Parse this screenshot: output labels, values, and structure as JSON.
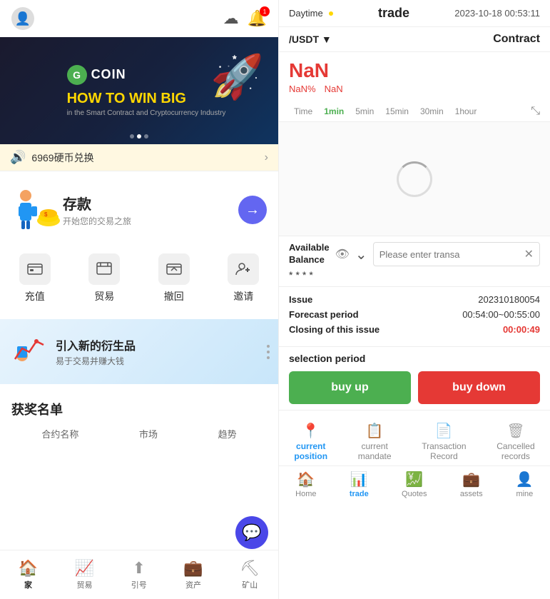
{
  "left": {
    "promo": {
      "icon": "🔊",
      "text": "6969硬币兑换",
      "arrow": "›"
    },
    "banner": {
      "logo": "G",
      "logo_text": "COIN",
      "line1": "HOW TO WIN BIG",
      "line2": "in the Smart Contract and Cryptocurrency Industry"
    },
    "deposit": {
      "title": "存款",
      "subtitle": "开始您的交易之旅"
    },
    "actions": [
      {
        "icon": "💳",
        "label": "充值"
      },
      {
        "icon": "📊",
        "label": "贸易"
      },
      {
        "icon": "↩",
        "label": "撤回"
      },
      {
        "icon": "👤",
        "label": "邀请"
      }
    ],
    "derivatives": {
      "title": "引入新的衍生品",
      "subtitle": "易于交易并赚大钱"
    },
    "winners": {
      "title": "获奖名单",
      "cols": [
        "合约名称",
        "市场",
        "趋势"
      ]
    },
    "nav": [
      {
        "icon": "🏠",
        "label": "家",
        "active": true
      },
      {
        "icon": "📈",
        "label": "贸易",
        "active": false
      },
      {
        "icon": "⬆",
        "label": "引号",
        "active": false
      },
      {
        "icon": "💼",
        "label": "资产",
        "active": false
      },
      {
        "icon": "⛏",
        "label": "矿山",
        "active": false
      }
    ]
  },
  "right": {
    "header": {
      "day": "Daytime",
      "day_dot_color": "#FFD700",
      "title": "trade",
      "time": "2023-10-18 00:53:11"
    },
    "pair": "/USDT ▼",
    "contract": "Contract",
    "price": {
      "main": "NaN",
      "pct": "NaN%",
      "val": "NaN"
    },
    "time_tabs": [
      "Time",
      "1min",
      "5min",
      "15min",
      "30min",
      "1hour"
    ],
    "active_tab": "1min",
    "balance": {
      "label": "Available\nBalance",
      "stars": "****",
      "placeholder": "Please enter transa"
    },
    "trade_info": {
      "issue_key": "Issue",
      "issue_val": "202310180054",
      "forecast_key": "Forecast period",
      "forecast_val": "00:54:00~00:55:00",
      "closing_key": "Closing of this issue",
      "closing_val": "00:00:49"
    },
    "selection": {
      "label": "selection period",
      "buy_up": "buy up",
      "buy_down": "buy down"
    },
    "tabs": [
      {
        "icon": "📍",
        "label": "current\nposition",
        "active": true
      },
      {
        "icon": "📋",
        "label": "current\nmandate",
        "active": false
      },
      {
        "icon": "📄",
        "label": "Transaction\nRecord",
        "active": false
      },
      {
        "icon": "🗑",
        "label": "Cancelled\nrecords",
        "active": false
      }
    ],
    "bottom_nav": [
      {
        "icon": "🏠",
        "label": "Home",
        "active": false
      },
      {
        "icon": "📊",
        "label": "trade",
        "active": true
      },
      {
        "icon": "💹",
        "label": "Quotes",
        "active": false
      },
      {
        "icon": "💼",
        "label": "assets",
        "active": false
      },
      {
        "icon": "👤",
        "label": "mine",
        "active": false
      }
    ]
  }
}
